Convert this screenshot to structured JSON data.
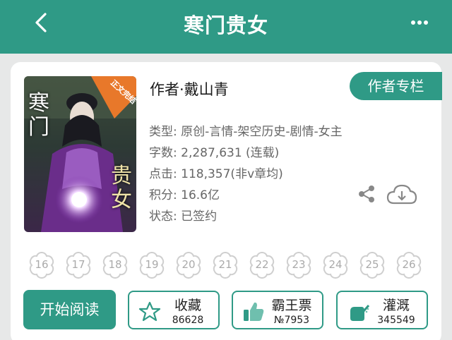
{
  "header": {
    "title": "寒门贵女",
    "back_icon": "chevron-left-icon",
    "more_icon": "more-dots-icon",
    "color": "#2f9a86"
  },
  "book": {
    "cover": {
      "badge": "正文完结",
      "title_top": "寒门",
      "title_bottom": "贵女"
    },
    "author": "作者·戴山青",
    "author_column_label": "作者专栏",
    "info": [
      "类型: 原创-言情-架空历史-剧情-女主",
      "字数: 2,287,631 (连载)",
      "点击: 118,357(非v章均)",
      "积分: 16.6亿",
      "状态: 已签约"
    ]
  },
  "icons": {
    "share": "share-icon",
    "download": "cloud-download-icon"
  },
  "flowers": [
    "16",
    "17",
    "18",
    "19",
    "20",
    "21",
    "22",
    "23",
    "24",
    "25",
    "26"
  ],
  "actions": {
    "read_label": "开始阅读",
    "collect": {
      "label": "收藏",
      "count": "86628",
      "icon": "star-icon"
    },
    "vote": {
      "label": "霸王票",
      "count": "№7953",
      "icon": "thumbs-up-icon"
    },
    "water": {
      "label": "灌溉",
      "count": "345549",
      "icon": "watering-can-icon"
    }
  }
}
